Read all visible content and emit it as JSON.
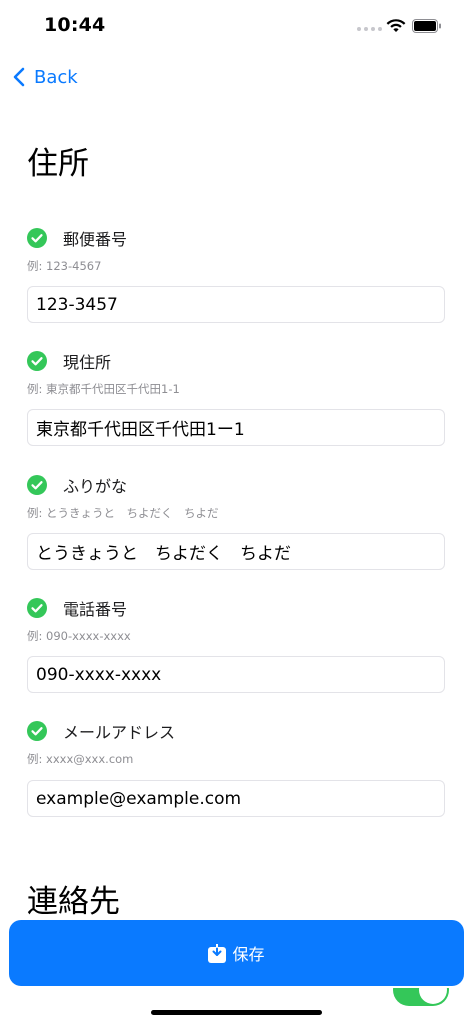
{
  "status_bar": {
    "time": "10:44"
  },
  "nav": {
    "back_label": "Back"
  },
  "address_section": {
    "title": "住所",
    "fields": [
      {
        "label": "郵便番号",
        "hint": "例: 123-4567",
        "value": "123-3457"
      },
      {
        "label": "現住所",
        "hint": "例: 東京都千代田区千代田1-1",
        "value": "東京都千代田区千代田1ー1"
      },
      {
        "label": "ふりがな",
        "hint": "例: とうきょうと　ちよだく　ちよだ",
        "value": "とうきょうと　ちよだく　ちよだ"
      },
      {
        "label": "電話番号",
        "hint": "例: 090-xxxx-xxxx",
        "value": "090-xxxx-xxxx"
      },
      {
        "label": "メールアドレス",
        "hint": "例: xxxx@xxx.com",
        "value": "example@example.com"
      }
    ]
  },
  "contact_section": {
    "title": "連絡先"
  },
  "save_button": {
    "label": "保存"
  },
  "colors": {
    "accent": "#0a7aff",
    "check_green": "#34c759",
    "hint_gray": "#8e8e93"
  },
  "icons": {
    "field_status": "checkmark-circle-icon",
    "save": "download-tray-icon"
  }
}
